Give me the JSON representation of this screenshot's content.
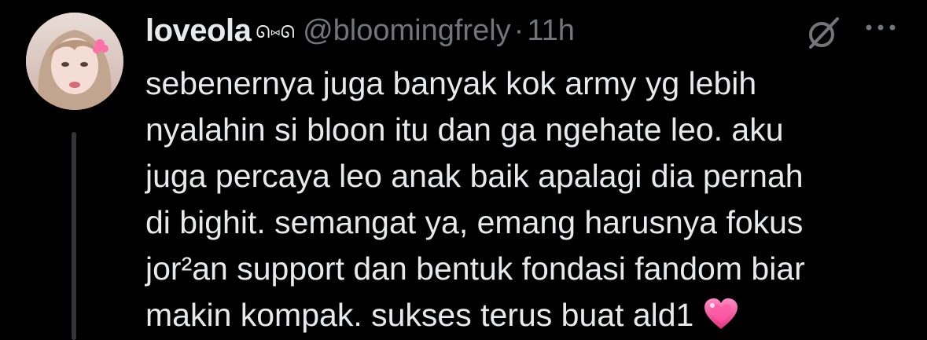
{
  "tweet": {
    "display_name": "loveola",
    "name_emoji": "ᘏ⑅ᘏ",
    "handle": "@bloomingfrely",
    "separator": "·",
    "time": "11h",
    "text_lines": [
      "sebenernya juga banyak kok army yg lebih",
      "nyalahin si bloon itu dan ga ngehate leo. aku",
      "juga percaya leo anak baik apalagi dia pernah",
      "di bighit. semangat ya, emang harusnya fokus",
      "jor²an support dan bentuk fondasi fandom biar",
      "makin kompak. sukses terus buat ald1"
    ],
    "end_emoji": "sparkling-heart-icon"
  },
  "colors": {
    "background": "#000000",
    "primary_text": "#e7e9ea",
    "secondary_text": "#71767b",
    "thread_line": "#333639",
    "heart": "#ff4fa8"
  }
}
